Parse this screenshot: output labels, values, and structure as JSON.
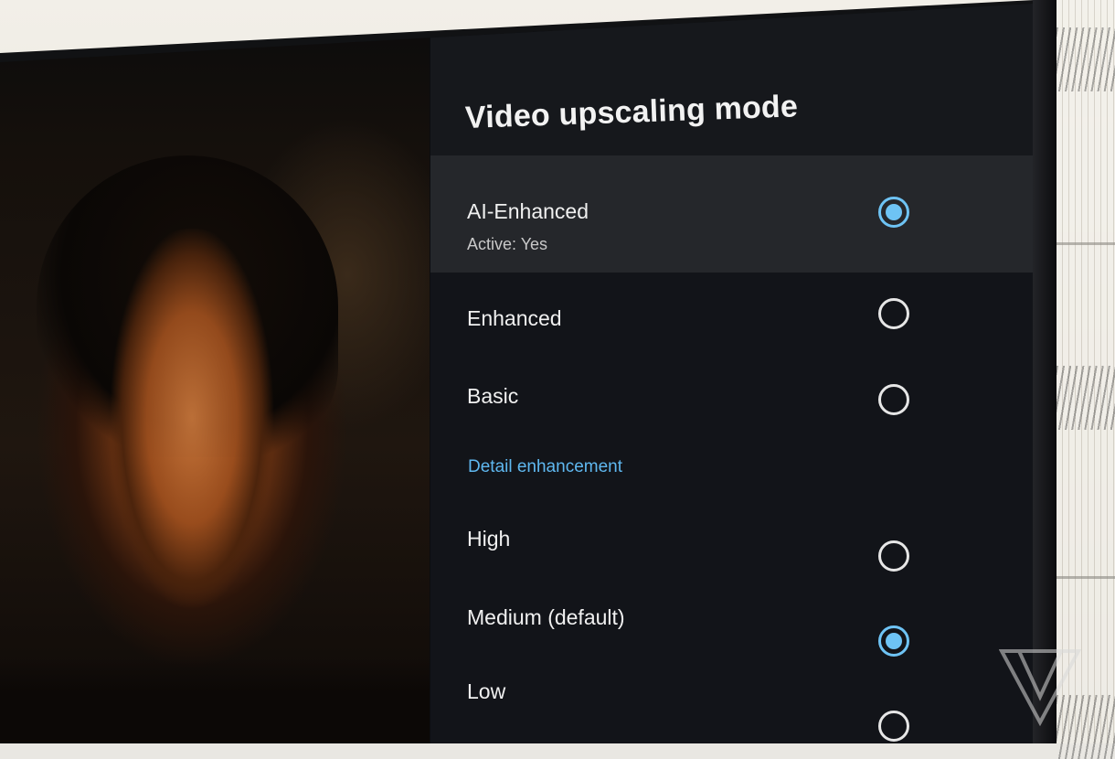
{
  "panel": {
    "title": "Video upscaling mode",
    "upscaling_options": [
      {
        "label": "AI-Enhanced",
        "subtitle": "Active: Yes",
        "checked": true
      },
      {
        "label": "Enhanced",
        "checked": false
      },
      {
        "label": "Basic",
        "checked": false
      }
    ],
    "section_label": "Detail enhancement",
    "detail_options": [
      {
        "label": "High",
        "checked": false
      },
      {
        "label": "Medium (default)",
        "checked": true
      },
      {
        "label": "Low",
        "checked": false
      }
    ]
  },
  "colors": {
    "accent": "#6ec3f4",
    "panel_bg": "#121419",
    "highlight_row": "#25272b"
  },
  "icons": {
    "radio_checked": "radio-checked-icon",
    "radio_unchecked": "radio-unchecked-icon",
    "watermark": "verge-logo-icon"
  }
}
